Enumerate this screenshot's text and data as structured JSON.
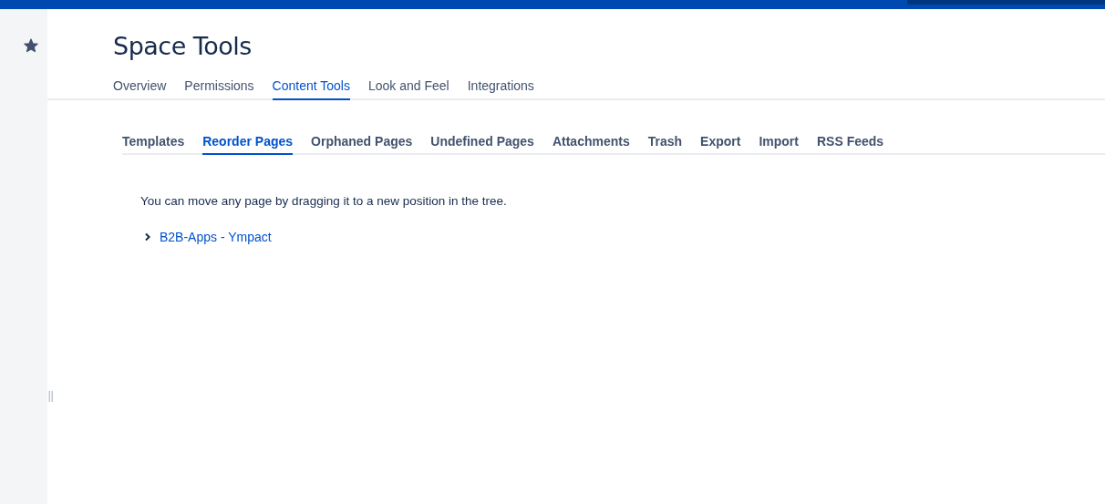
{
  "header": {
    "title": "Space Tools"
  },
  "tabs": [
    {
      "label": "Overview",
      "selected": false
    },
    {
      "label": "Permissions",
      "selected": false
    },
    {
      "label": "Content Tools",
      "selected": true
    },
    {
      "label": "Look and Feel",
      "selected": false
    },
    {
      "label": "Integrations",
      "selected": false
    }
  ],
  "subtabs": [
    {
      "label": "Templates",
      "selected": false
    },
    {
      "label": "Reorder Pages",
      "selected": true
    },
    {
      "label": "Orphaned Pages",
      "selected": false
    },
    {
      "label": "Undefined Pages",
      "selected": false
    },
    {
      "label": "Attachments",
      "selected": false
    },
    {
      "label": "Trash",
      "selected": false
    },
    {
      "label": "Export",
      "selected": false
    },
    {
      "label": "Import",
      "selected": false
    },
    {
      "label": "RSS Feeds",
      "selected": false
    }
  ],
  "instructions": "You can move any page by dragging it to a new position in the tree.",
  "tree": [
    {
      "label": "B2B-Apps - Ympact",
      "expanded": false
    }
  ]
}
